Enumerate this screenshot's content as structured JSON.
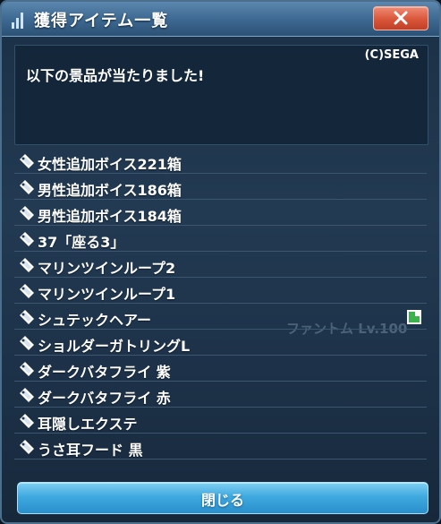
{
  "window": {
    "title": "獲得アイテム一覧",
    "close_icon": "close-x-icon"
  },
  "message_box": {
    "copyright": "(C)SEGA",
    "message": "以下の景品が当たりました!"
  },
  "items": [
    {
      "label": "女性追加ボイス221箱",
      "icon": "ticket-icon"
    },
    {
      "label": "男性追加ボイス186箱",
      "icon": "ticket-icon"
    },
    {
      "label": "男性追加ボイス184箱",
      "icon": "ticket-icon"
    },
    {
      "label": "37「座る3」",
      "icon": "ticket-icon"
    },
    {
      "label": "マリンツインループ2",
      "icon": "ticket-icon"
    },
    {
      "label": "マリンツインループ1",
      "icon": "ticket-icon"
    },
    {
      "label": "シュテックヘアー",
      "icon": "ticket-icon",
      "badge": "green-status-icon"
    },
    {
      "label": "ショルダーガトリングL",
      "icon": "ticket-icon"
    },
    {
      "label": "ダークバタフライ 紫",
      "icon": "ticket-icon"
    },
    {
      "label": "ダークバタフライ 赤",
      "icon": "ticket-icon"
    },
    {
      "label": "耳隠しエクステ",
      "icon": "ticket-icon"
    },
    {
      "label": "うさ耳フード 黒",
      "icon": "ticket-icon"
    }
  ],
  "background_text": "ファントム Lv.100",
  "footer": {
    "close_label": "閉じる"
  },
  "colors": {
    "title_bar": "#3e6a93",
    "close_button": "#d9563a",
    "ok_button": "#3fa9df",
    "badge_green": "#3bb34a"
  }
}
